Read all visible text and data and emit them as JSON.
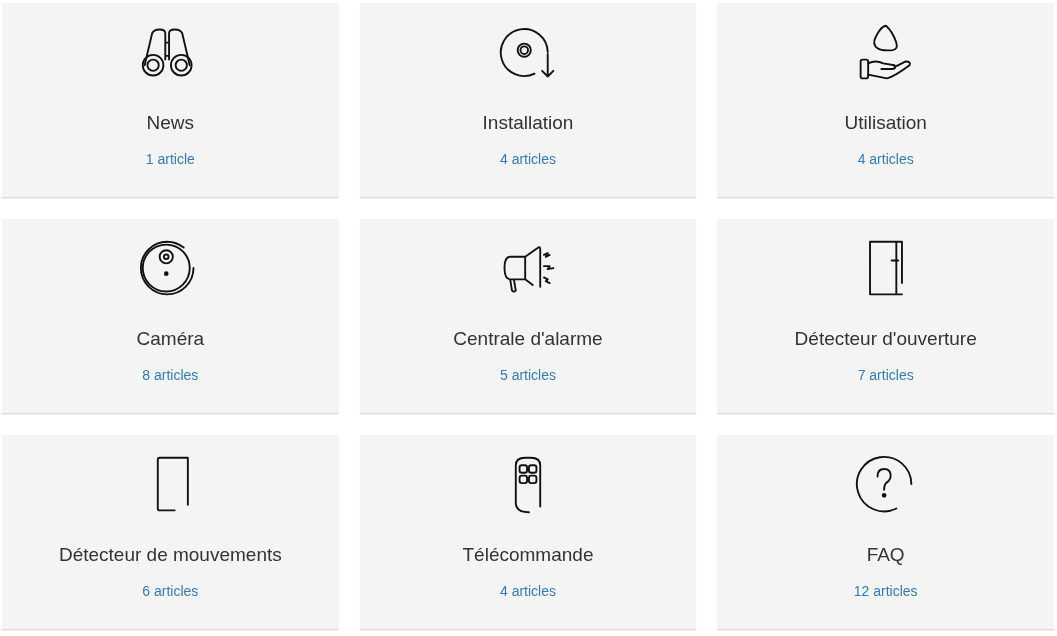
{
  "categories": [
    {
      "kind": "binoculars",
      "title": "News",
      "count": "1 article"
    },
    {
      "kind": "disc",
      "title": "Installation",
      "count": "4 articles"
    },
    {
      "kind": "hand",
      "title": "Utilisation",
      "count": "4 articles"
    },
    {
      "kind": "camera",
      "title": "Caméra",
      "count": "8 articles"
    },
    {
      "kind": "megaphone",
      "title": "Centrale d'alarme",
      "count": "5 articles"
    },
    {
      "kind": "door",
      "title": "Détecteur d'ouverture",
      "count": "7 articles"
    },
    {
      "kind": "sensor",
      "title": "Détecteur de mouvements",
      "count": "6 articles"
    },
    {
      "kind": "remote",
      "title": "Télécommande",
      "count": "4 articles"
    },
    {
      "kind": "question",
      "title": "FAQ",
      "count": "12 articles"
    }
  ]
}
